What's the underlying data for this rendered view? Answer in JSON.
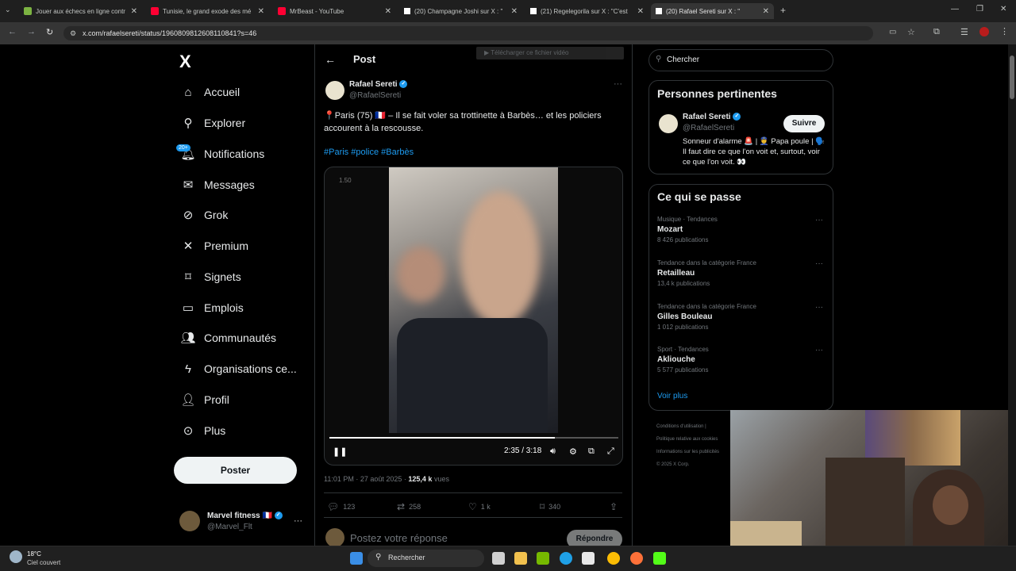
{
  "browser": {
    "tabs": [
      {
        "title": "Jouer aux échecs en ligne contr",
        "color": "#7cb342"
      },
      {
        "title": "Tunisie, le grand exode des mé",
        "color": "#ff0033"
      },
      {
        "title": "MrBeast - YouTube",
        "color": "#ff0033"
      },
      {
        "title": "(20) Champagne Joshi sur X : \"",
        "color": "#ffffff"
      },
      {
        "title": "(21) Regelegorila sur X : \"C'est",
        "color": "#ffffff"
      },
      {
        "title": "(20) Rafael Sereti sur X : \"",
        "color": "#ffffff"
      }
    ],
    "url": "x.com/rafaelsereti/status/1960809812608110841?s=46",
    "download_overlay": "Télécharger ce fichier vidéo"
  },
  "sidebar": {
    "logo": "X",
    "items": [
      {
        "label": "Accueil",
        "icon": "home-icon"
      },
      {
        "label": "Explorer",
        "icon": "search-icon"
      },
      {
        "label": "Notifications",
        "icon": "bell-icon",
        "badge": "20+"
      },
      {
        "label": "Messages",
        "icon": "envelope-icon"
      },
      {
        "label": "Grok",
        "icon": "grok-icon"
      },
      {
        "label": "Premium",
        "icon": "x-icon"
      },
      {
        "label": "Signets",
        "icon": "bookmark-icon"
      },
      {
        "label": "Emplois",
        "icon": "briefcase-icon"
      },
      {
        "label": "Communautés",
        "icon": "people-icon"
      },
      {
        "label": "Organisations ce...",
        "icon": "lightning-icon"
      },
      {
        "label": "Profil",
        "icon": "person-icon"
      },
      {
        "label": "Plus",
        "icon": "more-circle-icon"
      }
    ],
    "post_button": "Poster",
    "account": {
      "name": "Marvel fitness 🇫🇷",
      "handle": "@Marvel_Flt"
    }
  },
  "post": {
    "header": "Post",
    "author": {
      "name": "Rafael Sereti",
      "handle": "@RafaelSereti"
    },
    "text": "📍Paris (75) 🇫🇷 – Il se fait voler sa trottinette à Barbès… et les policiers accourent à la rescousse.",
    "hashtags": "#Paris #police #Barbès",
    "video": {
      "speed_label": "1.50",
      "time": "2:35 / 3:18",
      "progress": 0.78
    },
    "timestamp": "11:01 PM · 27 août 2025 · ",
    "views_count": "125,4 k",
    "views_label": " vues",
    "actions": {
      "replies": "123",
      "reposts": "258",
      "likes": "1 k",
      "bookmarks": "340"
    },
    "reply_placeholder": "Postez votre réponse",
    "reply_button": "Répondre"
  },
  "right": {
    "search_placeholder": "Chercher",
    "relevant_title": "Personnes pertinentes",
    "person": {
      "name": "Rafael Sereti",
      "handle": "@RafaelSereti",
      "follow": "Suivre",
      "bio": "Sonneur d'alarme 🚨 | 👮 Papa poule | 🗣️ Il faut dire ce que l'on voit et, surtout, voir ce que l'on voit. 👀"
    },
    "trends_title": "Ce qui se passe",
    "trends": [
      {
        "category": "Musique · Tendances",
        "name": "Mozart",
        "count": "8 426 publications"
      },
      {
        "category": "Tendance dans la catégorie France",
        "name": "Retailleau",
        "count": "13,4 k publications"
      },
      {
        "category": "Tendance dans la catégorie France",
        "name": "Gilles Bouleau",
        "count": "1 012 publications"
      },
      {
        "category": "Sport · Tendances",
        "name": "Akliouche",
        "count": "5 577 publications"
      }
    ],
    "see_more": "Voir plus",
    "footer": [
      "Conditions d'utilisation |",
      "Politique relative aux cookies",
      "Informations sur les publicités",
      "© 2025 X Corp."
    ]
  },
  "taskbar": {
    "weather_temp": "18°C",
    "weather_desc": "Ciel couvert",
    "search": "Rechercher"
  }
}
